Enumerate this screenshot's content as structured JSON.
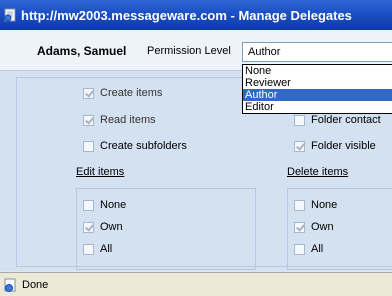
{
  "window": {
    "title": "http://mw2003.messageware.com - Manage Delegates",
    "icon": "ie-page-icon"
  },
  "header": {
    "user_name": "Adams, Samuel",
    "permission_label": "Permission Level",
    "permission_value": "Author",
    "options": [
      "None",
      "Reviewer",
      "Author",
      "Editor"
    ],
    "selected_option": "Author"
  },
  "checkboxes": {
    "create_items": "Create items",
    "read_items": "Read items",
    "create_subfolders": "Create subfolders",
    "folder_contact": "Folder contact",
    "folder_visible": "Folder visible"
  },
  "edit_items": {
    "title": "Edit items",
    "options": [
      "None",
      "Own",
      "All"
    ]
  },
  "delete_items": {
    "title": "Delete items",
    "options": [
      "None",
      "Own",
      "All"
    ]
  },
  "status": {
    "text": "Done",
    "icon": "ie-page-icon"
  }
}
